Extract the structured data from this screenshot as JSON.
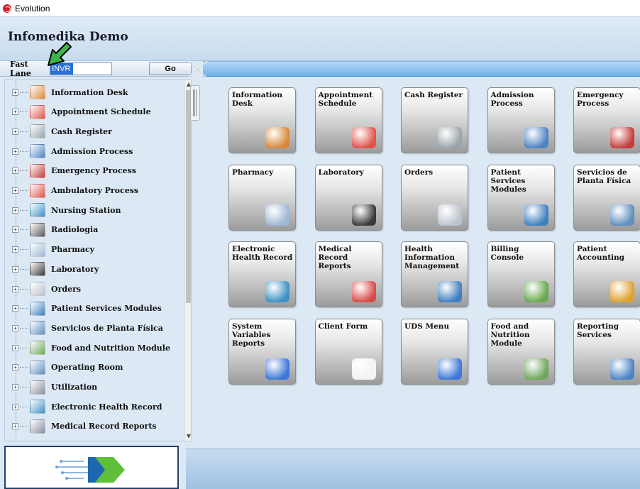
{
  "window": {
    "title": "Evolution"
  },
  "header": {
    "brand": "Infomedika Demo"
  },
  "fast_lane": {
    "label": "Fast Lane",
    "value": "INVR",
    "go_label": "Go"
  },
  "tree": {
    "items": [
      {
        "label": "Information Desk",
        "icon": "receptionist-icon",
        "color": "#d88a3a"
      },
      {
        "label": "Appointment Schedule",
        "icon": "calendar-icon",
        "color": "#e0524a"
      },
      {
        "label": "Cash Register",
        "icon": "cash-register-icon",
        "color": "#9aa4ab"
      },
      {
        "label": "Admission Process",
        "icon": "hospital-icon",
        "color": "#4e83c6"
      },
      {
        "label": "Emergency Process",
        "icon": "ambulance-icon",
        "color": "#c53b3b"
      },
      {
        "label": "Ambulatory Process",
        "icon": "calendar-icon",
        "color": "#e0524a"
      },
      {
        "label": "Nursing Station",
        "icon": "nurse-icon",
        "color": "#3d91c7"
      },
      {
        "label": "Radiologia",
        "icon": "xray-icon",
        "color": "#5a5a5a"
      },
      {
        "label": "Pharmacy",
        "icon": "pharmacy-icon",
        "color": "#9fb7d4"
      },
      {
        "label": "Laboratory",
        "icon": "microscope-icon",
        "color": "#3a3a3a"
      },
      {
        "label": "Orders",
        "icon": "document-icon",
        "color": "#bcc4cc"
      },
      {
        "label": "Patient Services Modules",
        "icon": "doctor-icon",
        "color": "#3f7fc0"
      },
      {
        "label": "Servicios de Planta Física",
        "icon": "maintenance-icon",
        "color": "#5f8fc0"
      },
      {
        "label": "Food and Nutrition Module",
        "icon": "food-icon",
        "color": "#6fa65a"
      },
      {
        "label": "Operating Room",
        "icon": "maintenance-icon",
        "color": "#5f8fc0"
      },
      {
        "label": "Utilization",
        "icon": "clipboard-icon",
        "color": "#8a8fa0"
      },
      {
        "label": "Electronic Health Record",
        "icon": "nurse-icon",
        "color": "#3d91c7"
      },
      {
        "label": "Medical Record  Reports",
        "icon": "clipboard-icon",
        "color": "#8a8fa0"
      }
    ]
  },
  "tiles": [
    {
      "label": "Information Desk",
      "icon": "receptionist-icon",
      "color": "#d88a3a"
    },
    {
      "label": "Appointment Schedule",
      "icon": "calendar-icon",
      "color": "#e0524a"
    },
    {
      "label": "Cash Register",
      "icon": "cash-register-icon",
      "color": "#9aa4ab"
    },
    {
      "label": "Admission Process",
      "icon": "hospital-icon",
      "color": "#4e83c6"
    },
    {
      "label": "Emergency Process",
      "icon": "ambulance-icon",
      "color": "#c53b3b"
    },
    {
      "label": "Pharmacy",
      "icon": "pharmacy-icon",
      "color": "#9fb7d4"
    },
    {
      "label": "Laboratory",
      "icon": "microscope-icon",
      "color": "#3a3a3a"
    },
    {
      "label": "Orders",
      "icon": "document-icon",
      "color": "#bcc4cc"
    },
    {
      "label": "Patient Services Modules",
      "icon": "doctor-icon",
      "color": "#3f7fc0"
    },
    {
      "label": "Servicios de Planta Física",
      "icon": "maintenance-icon",
      "color": "#5f8fc0"
    },
    {
      "label": "Electronic Health Record",
      "icon": "nurse-icon",
      "color": "#3d91c7"
    },
    {
      "label": "Medical Record Reports",
      "icon": "first-aid-icon",
      "color": "#d94a4a"
    },
    {
      "label": "Health Information Management",
      "icon": "doctor-icon",
      "color": "#3f7fc0"
    },
    {
      "label": "Billing Console",
      "icon": "cashier-icon",
      "color": "#6aa84f"
    },
    {
      "label": "Patient Accounting",
      "icon": "accountant-icon",
      "color": "#e0a12f"
    },
    {
      "label": "System Variables Reports",
      "icon": "pie-chart-icon",
      "color": "#3c78d8"
    },
    {
      "label": "Client Form",
      "icon": "checklist-icon",
      "color": "#f2f2f2"
    },
    {
      "label": "UDS Menu",
      "icon": "pie-chart-icon",
      "color": "#3c78d8"
    },
    {
      "label": "Food and Nutrition Module",
      "icon": "food-icon",
      "color": "#6fa65a"
    },
    {
      "label": "Reporting Services",
      "icon": "report-icon",
      "color": "#4e83c6"
    }
  ]
}
